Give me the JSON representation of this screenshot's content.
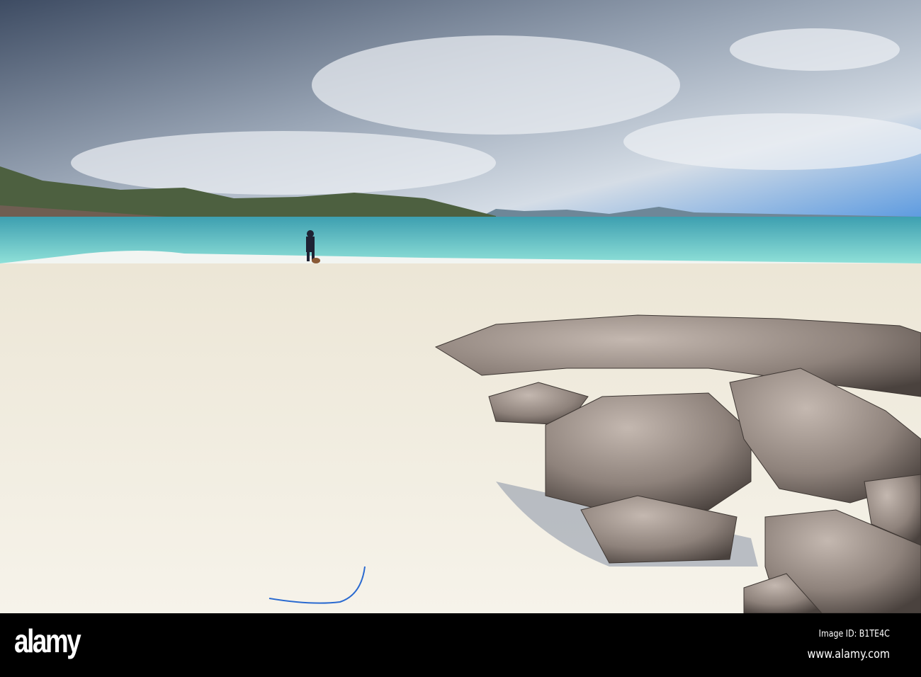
{
  "watermark": {
    "logo": "alamy",
    "image_id": "Image ID: B1TE4C",
    "site": "www.alamy.com"
  },
  "colors": {
    "sky_top": "#4a5f7e",
    "sky_blue": "#4f8fd6",
    "sea": "#5cc3c3",
    "sand": "#f1ede0",
    "rock": "#8a7f78"
  }
}
